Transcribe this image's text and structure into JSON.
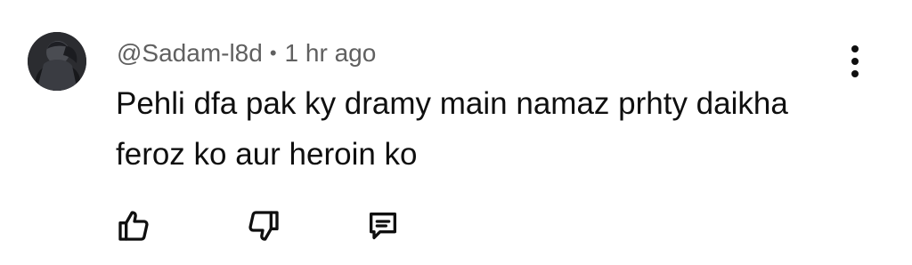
{
  "comment": {
    "author": "@Sadam-l8d",
    "separator": "•",
    "time": "1 hr ago",
    "text": "Pehli dfa pak ky dramy main namaz prhty daikha feroz ko aur heroin ko"
  },
  "icons": {
    "avatar": "avatar-image",
    "more": "more-vertical-icon",
    "like": "thumbs-up-icon",
    "dislike": "thumbs-down-icon",
    "reply": "reply-comment-icon"
  },
  "colors": {
    "text": "#0f0f0f",
    "secondary_text": "#606060",
    "background": "#ffffff"
  }
}
